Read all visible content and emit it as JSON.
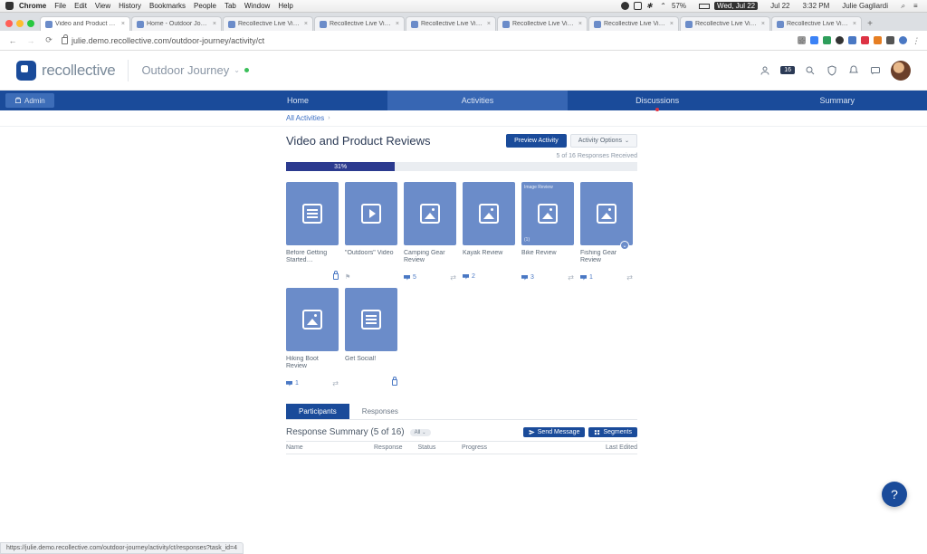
{
  "mac": {
    "app": "Chrome",
    "menus": [
      "File",
      "Edit",
      "View",
      "History",
      "Bookmarks",
      "People",
      "Tab",
      "Window",
      "Help"
    ],
    "battery": "57%",
    "day": "Wed, Jul 22",
    "date": "Jul 22",
    "time": "3:32 PM",
    "user": "Julie Gagliardi"
  },
  "tabs": [
    {
      "label": "Video and Product Review…",
      "active": true
    },
    {
      "label": "Home - Outdoor Journey"
    },
    {
      "label": "Recollective Live Video Int…"
    },
    {
      "label": "Recollective Live Video Int…"
    },
    {
      "label": "Recollective Live Video Int…"
    },
    {
      "label": "Recollective Live Video Int…"
    },
    {
      "label": "Recollective Live Video Int…"
    },
    {
      "label": "Recollective Live Video Int…"
    },
    {
      "label": "Recollective Live Video Int…"
    }
  ],
  "url": "julie.demo.recollective.com/outdoor-journey/activity/ct",
  "brand": "recollective",
  "project": "Outdoor Journey",
  "hdr_badge": "16",
  "nav": {
    "admin": "Admin",
    "items": [
      "Home",
      "Activities",
      "Discussions",
      "Summary"
    ]
  },
  "crumb": "All Activities",
  "page_title": "Video and Product Reviews",
  "preview_btn": "Preview Activity",
  "options_btn": "Activity Options",
  "responses_meta": "5 of 16 Responses Received",
  "progress_pct": "31%",
  "cards": [
    {
      "title": "Before Getting Started…",
      "icon": "lines",
      "lock": true
    },
    {
      "title": "\"Outdoors\" Video",
      "icon": "play",
      "flag": true
    },
    {
      "title": "Camping Gear Review",
      "icon": "mount",
      "count": "5",
      "shuffle": true
    },
    {
      "title": "Kayak Review",
      "icon": "mount",
      "count": "2"
    },
    {
      "title": "Bike Review",
      "icon": "mount",
      "count": "3",
      "shuffle": true,
      "toplabel": "Image Review",
      "sublabel": "(1)"
    },
    {
      "title": "Fishing Gear Review",
      "icon": "mount",
      "count": "1",
      "shuffle": true,
      "badge": true
    },
    {
      "title": "Hiking Boot Review",
      "icon": "mount",
      "count": "1",
      "shuffle": true
    },
    {
      "title": "Get Social!",
      "icon": "lines",
      "lock": true
    }
  ],
  "subtabs": [
    "Participants",
    "Responses"
  ],
  "summary_title": "Response Summary (5 of 16)",
  "summary_pill": "All",
  "send_msg": "Send Message",
  "segments": "Segments",
  "table_cols": [
    "Name",
    "Response",
    "Status",
    "Progress",
    "",
    "Last Edited"
  ],
  "status_url": "https://julie.demo.recollective.com/outdoor-journey/activity/ct/responses?task_id=4"
}
